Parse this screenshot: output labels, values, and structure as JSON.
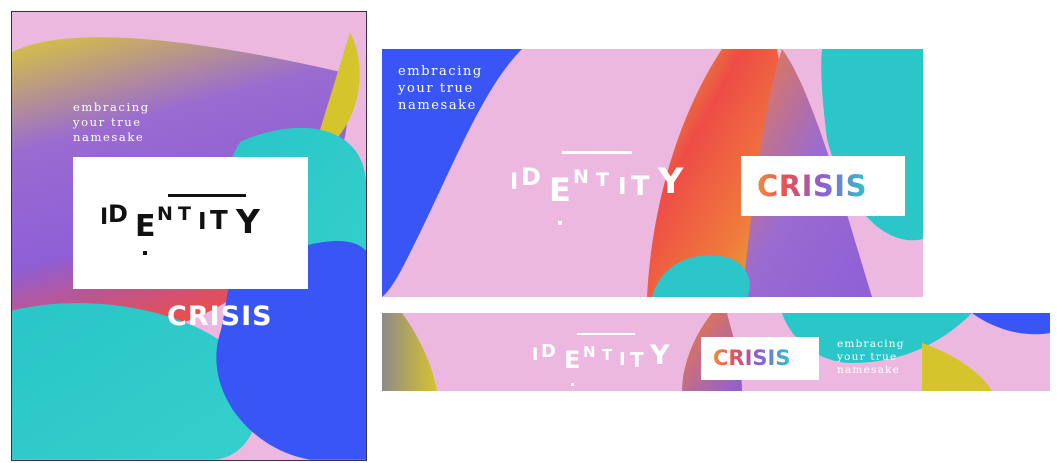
{
  "tagline": "embracing\nyour true\nnamesake",
  "identity": {
    "letters": [
      "I",
      "D",
      "E",
      "N",
      "T",
      "I",
      "T",
      "Y"
    ]
  },
  "crisis": "CRISIS",
  "colors": {
    "pink": "#ecb8e0",
    "blue": "#3a55f5",
    "teal": "#2ac6c8",
    "purple": "#8e5fd6",
    "red": "#ee4c46",
    "yellow": "#d6c42c",
    "white": "#ffffff",
    "black": "#111111"
  }
}
